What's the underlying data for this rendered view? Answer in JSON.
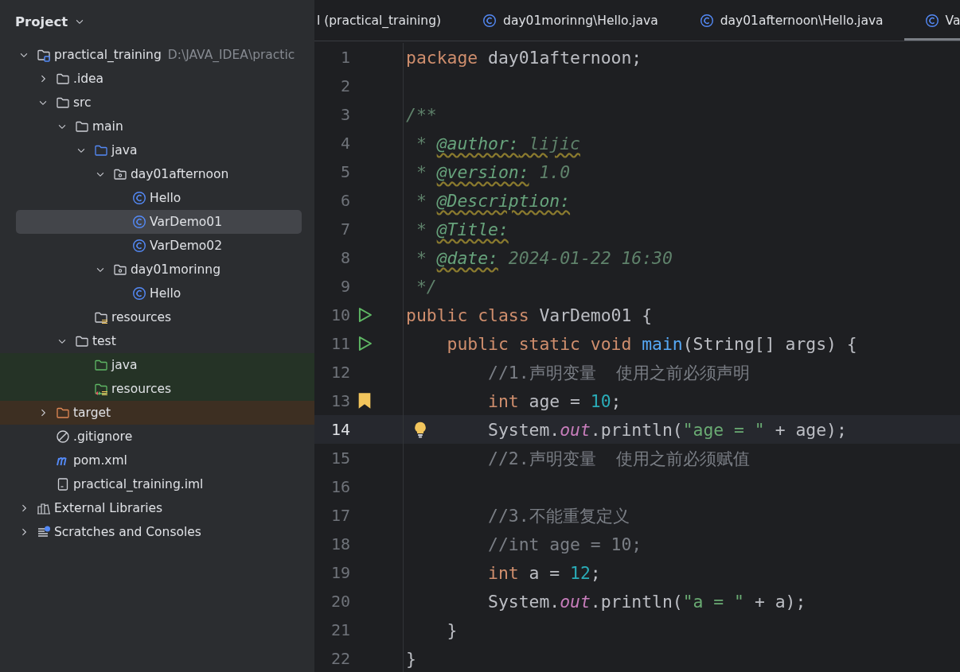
{
  "sidebar": {
    "title": "Project",
    "tree": [
      {
        "label": "practical_training",
        "path": "D:\\JAVA_IDEA\\practic",
        "kind": "module",
        "expanded": true,
        "selected": false,
        "children": [
          {
            "label": ".idea",
            "kind": "folder",
            "expanded": false,
            "selected": false
          },
          {
            "label": "src",
            "kind": "folder",
            "expanded": true,
            "selected": false,
            "children": [
              {
                "label": "main",
                "kind": "folder",
                "expanded": true,
                "selected": false,
                "children": [
                  {
                    "label": "java",
                    "kind": "source",
                    "expanded": true,
                    "selected": false,
                    "children": [
                      {
                        "label": "day01afternoon",
                        "kind": "package",
                        "expanded": true,
                        "selected": false,
                        "children": [
                          {
                            "label": "Hello",
                            "kind": "class",
                            "selected": false
                          },
                          {
                            "label": "VarDemo01",
                            "kind": "class",
                            "selected": true
                          },
                          {
                            "label": "VarDemo02",
                            "kind": "class",
                            "selected": false
                          }
                        ]
                      },
                      {
                        "label": "day01morinng",
                        "kind": "package",
                        "expanded": true,
                        "selected": false,
                        "children": [
                          {
                            "label": "Hello",
                            "kind": "class",
                            "selected": false
                          }
                        ]
                      }
                    ]
                  },
                  {
                    "label": "resources",
                    "kind": "resources",
                    "selected": false
                  }
                ]
              },
              {
                "label": "test",
                "kind": "folder",
                "expanded": true,
                "selected": false,
                "children": [
                  {
                    "label": "java",
                    "kind": "testsource",
                    "selected": false,
                    "color": "#253326"
                  },
                  {
                    "label": "resources",
                    "kind": "testresources",
                    "selected": false,
                    "color": "#253326"
                  }
                ]
              }
            ]
          },
          {
            "label": "target",
            "kind": "excluded",
            "expanded": false,
            "selected": false,
            "color": "#3d2f22"
          },
          {
            "label": ".gitignore",
            "kind": "ignore",
            "selected": false
          },
          {
            "label": "pom.xml",
            "kind": "maven",
            "selected": false
          },
          {
            "label": "practical_training.iml",
            "kind": "file",
            "selected": false
          }
        ]
      },
      {
        "label": "External Libraries",
        "kind": "library",
        "expanded": false,
        "selected": false
      },
      {
        "label": "Scratches and Consoles",
        "kind": "scratches",
        "expanded": false,
        "selected": false
      }
    ]
  },
  "editor": {
    "tabs": [
      {
        "label": "l (practical_training)",
        "icon": false,
        "selected": false
      },
      {
        "label": "day01morinng\\Hello.java",
        "icon": true,
        "selected": false
      },
      {
        "label": "day01afternoon\\Hello.java",
        "icon": true,
        "selected": false
      },
      {
        "label": "Va",
        "icon": true,
        "selected": true
      }
    ],
    "lines": [
      {
        "number": "1",
        "current": false,
        "tokens": [
          {
            "kind": "kw",
            "text": "package"
          },
          {
            "kind": "plain",
            "text": " day01afternoon;"
          }
        ]
      },
      {
        "number": "2",
        "current": false
      },
      {
        "number": "3",
        "current": false,
        "tokens": [
          {
            "kind": "doc",
            "text": "/**"
          }
        ]
      },
      {
        "number": "4",
        "current": false,
        "tokens": [
          {
            "kind": "doc",
            "text": " * "
          },
          {
            "kind": "doctag",
            "text": "@author:"
          },
          {
            "kind": "typo",
            "text": " lijic"
          }
        ]
      },
      {
        "number": "5",
        "current": false,
        "tokens": [
          {
            "kind": "doc",
            "text": " * "
          },
          {
            "kind": "doctag",
            "text": "@version:"
          },
          {
            "kind": "doc",
            "text": " 1.0"
          }
        ]
      },
      {
        "number": "6",
        "current": false,
        "tokens": [
          {
            "kind": "doc",
            "text": " * "
          },
          {
            "kind": "doctag",
            "text": "@Description:"
          }
        ]
      },
      {
        "number": "7",
        "current": false,
        "tokens": [
          {
            "kind": "doc",
            "text": " * "
          },
          {
            "kind": "doctag",
            "text": "@Title:"
          }
        ]
      },
      {
        "number": "8",
        "current": false,
        "tokens": [
          {
            "kind": "doc",
            "text": " * "
          },
          {
            "kind": "doctag",
            "text": "@date:"
          },
          {
            "kind": "doc",
            "text": " 2024-01-22 16:30"
          }
        ]
      },
      {
        "number": "9",
        "current": false,
        "tokens": [
          {
            "kind": "doc",
            "text": " */"
          }
        ]
      },
      {
        "number": "10",
        "current": false,
        "gutter_icon": {
          "kind": "run"
        },
        "tokens": [
          {
            "kind": "kw",
            "text": "public class"
          },
          {
            "kind": "plain",
            "text": " VarDemo01 {"
          }
        ],
        "children": [
          {
            "number": "11",
            "current": false,
            "gutter_icon": {
              "kind": "run"
            },
            "tokens": [
              {
                "kind": "kw",
                "text": "public static void"
              },
              {
                "kind": "fn",
                "text": " main"
              },
              {
                "kind": "plain",
                "text": "(String[] args) {"
              }
            ],
            "children": [
              {
                "number": "12",
                "current": false,
                "tokens": [
                  {
                    "kind": "comment",
                    "text": "//1.声明变量  使用之前必须声明"
                  }
                ]
              },
              {
                "number": "13",
                "current": false,
                "gutter_icon": {
                  "kind": "bookmark"
                },
                "tokens": [
                  {
                    "kind": "kw",
                    "text": "int"
                  },
                  {
                    "kind": "plain",
                    "text": " age = "
                  },
                  {
                    "kind": "num",
                    "text": "10"
                  },
                  {
                    "kind": "plain",
                    "text": ";"
                  }
                ]
              },
              {
                "number": "14",
                "current": true,
                "gutter_icon": {
                  "kind": "bulb"
                },
                "tokens": [
                  {
                    "kind": "plain",
                    "text": "System."
                  },
                  {
                    "kind": "field",
                    "text": "out"
                  },
                  {
                    "kind": "plain",
                    "text": ".println("
                  },
                  {
                    "kind": "str",
                    "text": "\"age = \""
                  },
                  {
                    "kind": "plain",
                    "text": " + age);"
                  }
                ]
              },
              {
                "number": "15",
                "current": false,
                "tokens": [
                  {
                    "kind": "comment",
                    "text": "//2.声明变量  使用之前必须赋值"
                  }
                ]
              },
              {
                "number": "16",
                "current": false
              },
              {
                "number": "17",
                "current": false,
                "tokens": [
                  {
                    "kind": "comment",
                    "text": "//3.不能重复定义"
                  }
                ]
              },
              {
                "number": "18",
                "current": false,
                "tokens": [
                  {
                    "kind": "comment",
                    "text": "//int age = 10;"
                  }
                ]
              },
              {
                "number": "19",
                "current": false,
                "tokens": [
                  {
                    "kind": "kw",
                    "text": "int"
                  },
                  {
                    "kind": "plain",
                    "text": " a = "
                  },
                  {
                    "kind": "num",
                    "text": "12"
                  },
                  {
                    "kind": "plain",
                    "text": ";"
                  }
                ]
              },
              {
                "number": "20",
                "current": false,
                "tokens": [
                  {
                    "kind": "plain",
                    "text": "System."
                  },
                  {
                    "kind": "field",
                    "text": "out"
                  },
                  {
                    "kind": "plain",
                    "text": ".println("
                  },
                  {
                    "kind": "str",
                    "text": "\"a = \""
                  },
                  {
                    "kind": "plain",
                    "text": " + a);"
                  }
                ]
              }
            ]
          },
          {
            "number": "21",
            "current": false,
            "tokens": [
              {
                "kind": "plain",
                "text": "}"
              }
            ]
          }
        ]
      },
      {
        "number": "22",
        "current": false,
        "tokens": [
          {
            "kind": "plain",
            "text": "}"
          }
        ]
      }
    ]
  }
}
